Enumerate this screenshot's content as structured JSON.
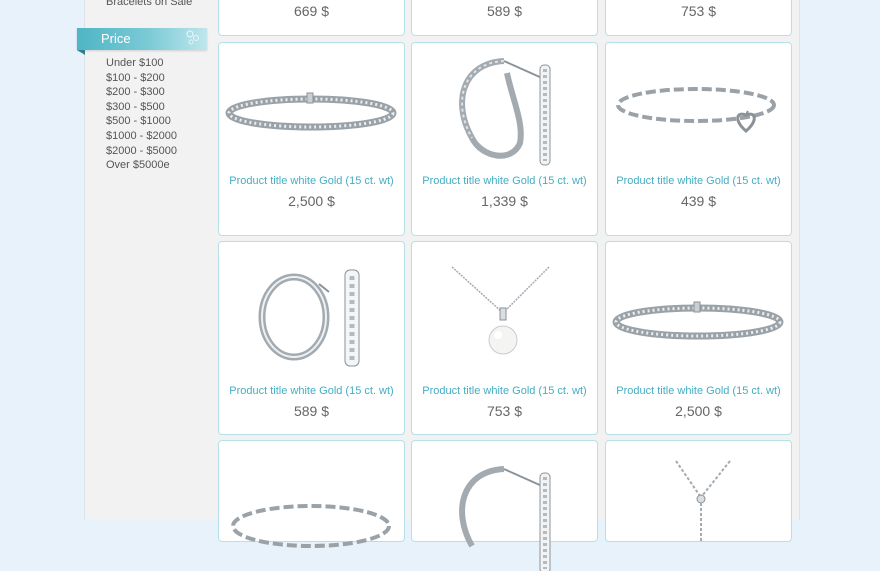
{
  "sidebar": {
    "sale_link": "Bracelets on Sale",
    "price_heading": "Price",
    "price_ranges": [
      "Under $100",
      "$100 - $200",
      "$200 - $300",
      "$300 - $500",
      "$500 - $1000",
      "$1000 - $2000",
      "$2000 - $5000",
      "Over $5000e"
    ]
  },
  "products": {
    "row0": [
      {
        "price": "669 $"
      },
      {
        "price": "589 $"
      },
      {
        "price": "753 $"
      }
    ],
    "row1": [
      {
        "title": "Product title white Gold (15 ct. wt)",
        "price": "2,500 $",
        "image": "tennis-bracelet-icon"
      },
      {
        "title": "Product title white Gold (15 ct. wt)",
        "price": "1,339 $",
        "image": "huggie-earrings-icon"
      },
      {
        "title": "Product title white Gold (15 ct. wt)",
        "price": "439 $",
        "image": "heart-charm-bracelet-icon"
      }
    ],
    "row2": [
      {
        "title": "Product title white Gold (15 ct. wt)",
        "price": "589 $",
        "image": "hoop-earrings-icon"
      },
      {
        "title": "Product title white Gold (15 ct. wt)",
        "price": "753 $",
        "image": "pearl-pendant-icon"
      },
      {
        "title": "Product title white Gold (15 ct. wt)",
        "price": "2,500 $",
        "image": "tennis-bracelet-icon"
      }
    ],
    "row3": [
      {
        "image": "chain-bracelet-icon"
      },
      {
        "image": "huggie-earrings-icon"
      },
      {
        "image": "lariat-necklace-icon"
      }
    ]
  },
  "colors": {
    "accent": "#44aec3",
    "card_border": "#b6e0e6",
    "price_text": "#666666",
    "background": "#e8f2fb"
  }
}
